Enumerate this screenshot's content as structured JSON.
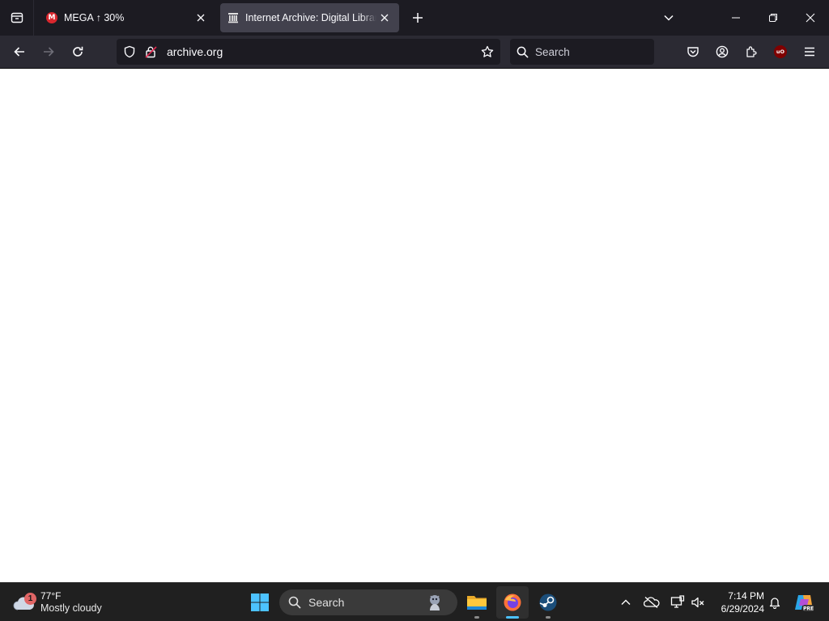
{
  "browser": {
    "tabs": [
      {
        "title": "MEGA ↑ 30%",
        "favicon": "mega-icon",
        "active": false
      },
      {
        "title": "Internet Archive: Digital Library of Free & Borrowable Books, Movies, Music & Wayback Machine",
        "favicon": "archive-icon",
        "active": true
      }
    ],
    "mega_favicon_letter": "M",
    "url": "archive.org",
    "search_placeholder": "Search",
    "ublock_label": "uO",
    "accent_color": "#42414d"
  },
  "taskbar": {
    "weather": {
      "temp": "77°F",
      "condition": "Mostly cloudy",
      "badge": "1"
    },
    "search_label": "Search",
    "apps": [
      "file-explorer",
      "firefox",
      "steam"
    ],
    "clock": {
      "time": "7:14 PM",
      "date": "6/29/2024"
    },
    "copilot_label": "PRE"
  }
}
